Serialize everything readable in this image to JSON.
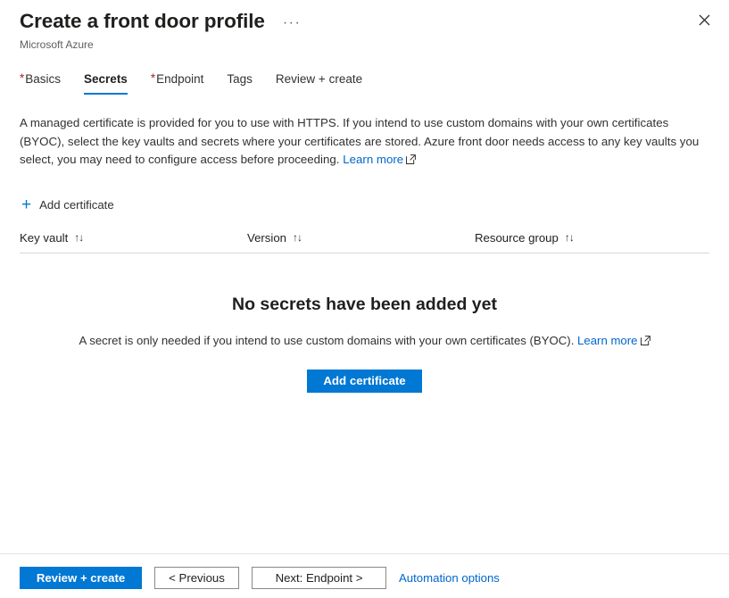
{
  "header": {
    "title": "Create a front door profile",
    "subtitle": "Microsoft Azure",
    "ellipsis_label": "···",
    "close_label": "Close"
  },
  "tabs": [
    {
      "label": "Basics",
      "required": true,
      "active": false
    },
    {
      "label": "Secrets",
      "required": false,
      "active": true
    },
    {
      "label": "Endpoint",
      "required": true,
      "active": false
    },
    {
      "label": "Tags",
      "required": false,
      "active": false
    },
    {
      "label": "Review + create",
      "required": false,
      "active": false
    }
  ],
  "intro": {
    "text": "A managed certificate is provided for you to use with HTTPS. If you intend to use custom domains with your own certificates (BYOC), select the key vaults and secrets where your certificates are stored. Azure front door needs access to any key vaults you select, you may need to configure access before proceeding.",
    "learn_more": "Learn more"
  },
  "command_bar": {
    "add_certificate": "Add certificate",
    "plus_icon": "+"
  },
  "table": {
    "columns": [
      {
        "label": "Key vault",
        "sort": "↑↓"
      },
      {
        "label": "Version",
        "sort": "↑↓"
      },
      {
        "label": "Resource group",
        "sort": "↑↓"
      }
    ]
  },
  "empty_state": {
    "title": "No secrets have been added yet",
    "description": "A secret is only needed if you intend to use custom domains with your own certificates (BYOC).",
    "learn_more": "Learn more",
    "button": "Add certificate"
  },
  "footer": {
    "review_create": "Review + create",
    "previous": "< Previous",
    "next": "Next: Endpoint >",
    "automation": "Automation options"
  },
  "colors": {
    "accent": "#0078d4",
    "link": "#0066cc",
    "required": "#a4262c",
    "text": "#323130",
    "subtle": "#605e5c"
  }
}
